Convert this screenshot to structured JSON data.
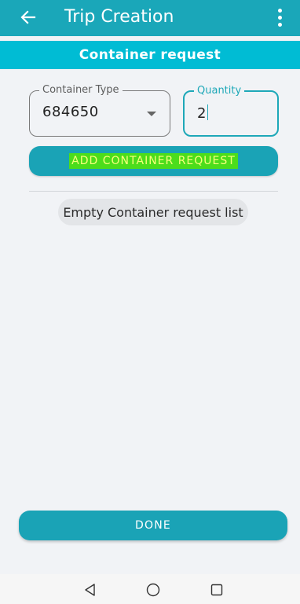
{
  "appbar": {
    "title": "Trip Creation",
    "back_icon": "arrow-left-icon",
    "menu_icon": "more-vertical-icon"
  },
  "subheader": {
    "title": "Container request"
  },
  "form": {
    "container_type": {
      "label": "Container Type",
      "value": "684650"
    },
    "quantity": {
      "label": "Quantity",
      "value": "2"
    },
    "add_button_label": "ADD CONTAINER REQUEST"
  },
  "list": {
    "empty_text": "Empty Container request list"
  },
  "footer": {
    "done_label": "DONE"
  },
  "navbar": {
    "back_icon": "triangle-back-icon",
    "home_icon": "circle-home-icon",
    "recent_icon": "square-recents-icon"
  },
  "colors": {
    "appbar": "#1aa7b9",
    "subheader": "#00bcd4",
    "button": "#1aa3b6",
    "highlight": "#4cdd1b",
    "background": "#f1f3f6"
  }
}
